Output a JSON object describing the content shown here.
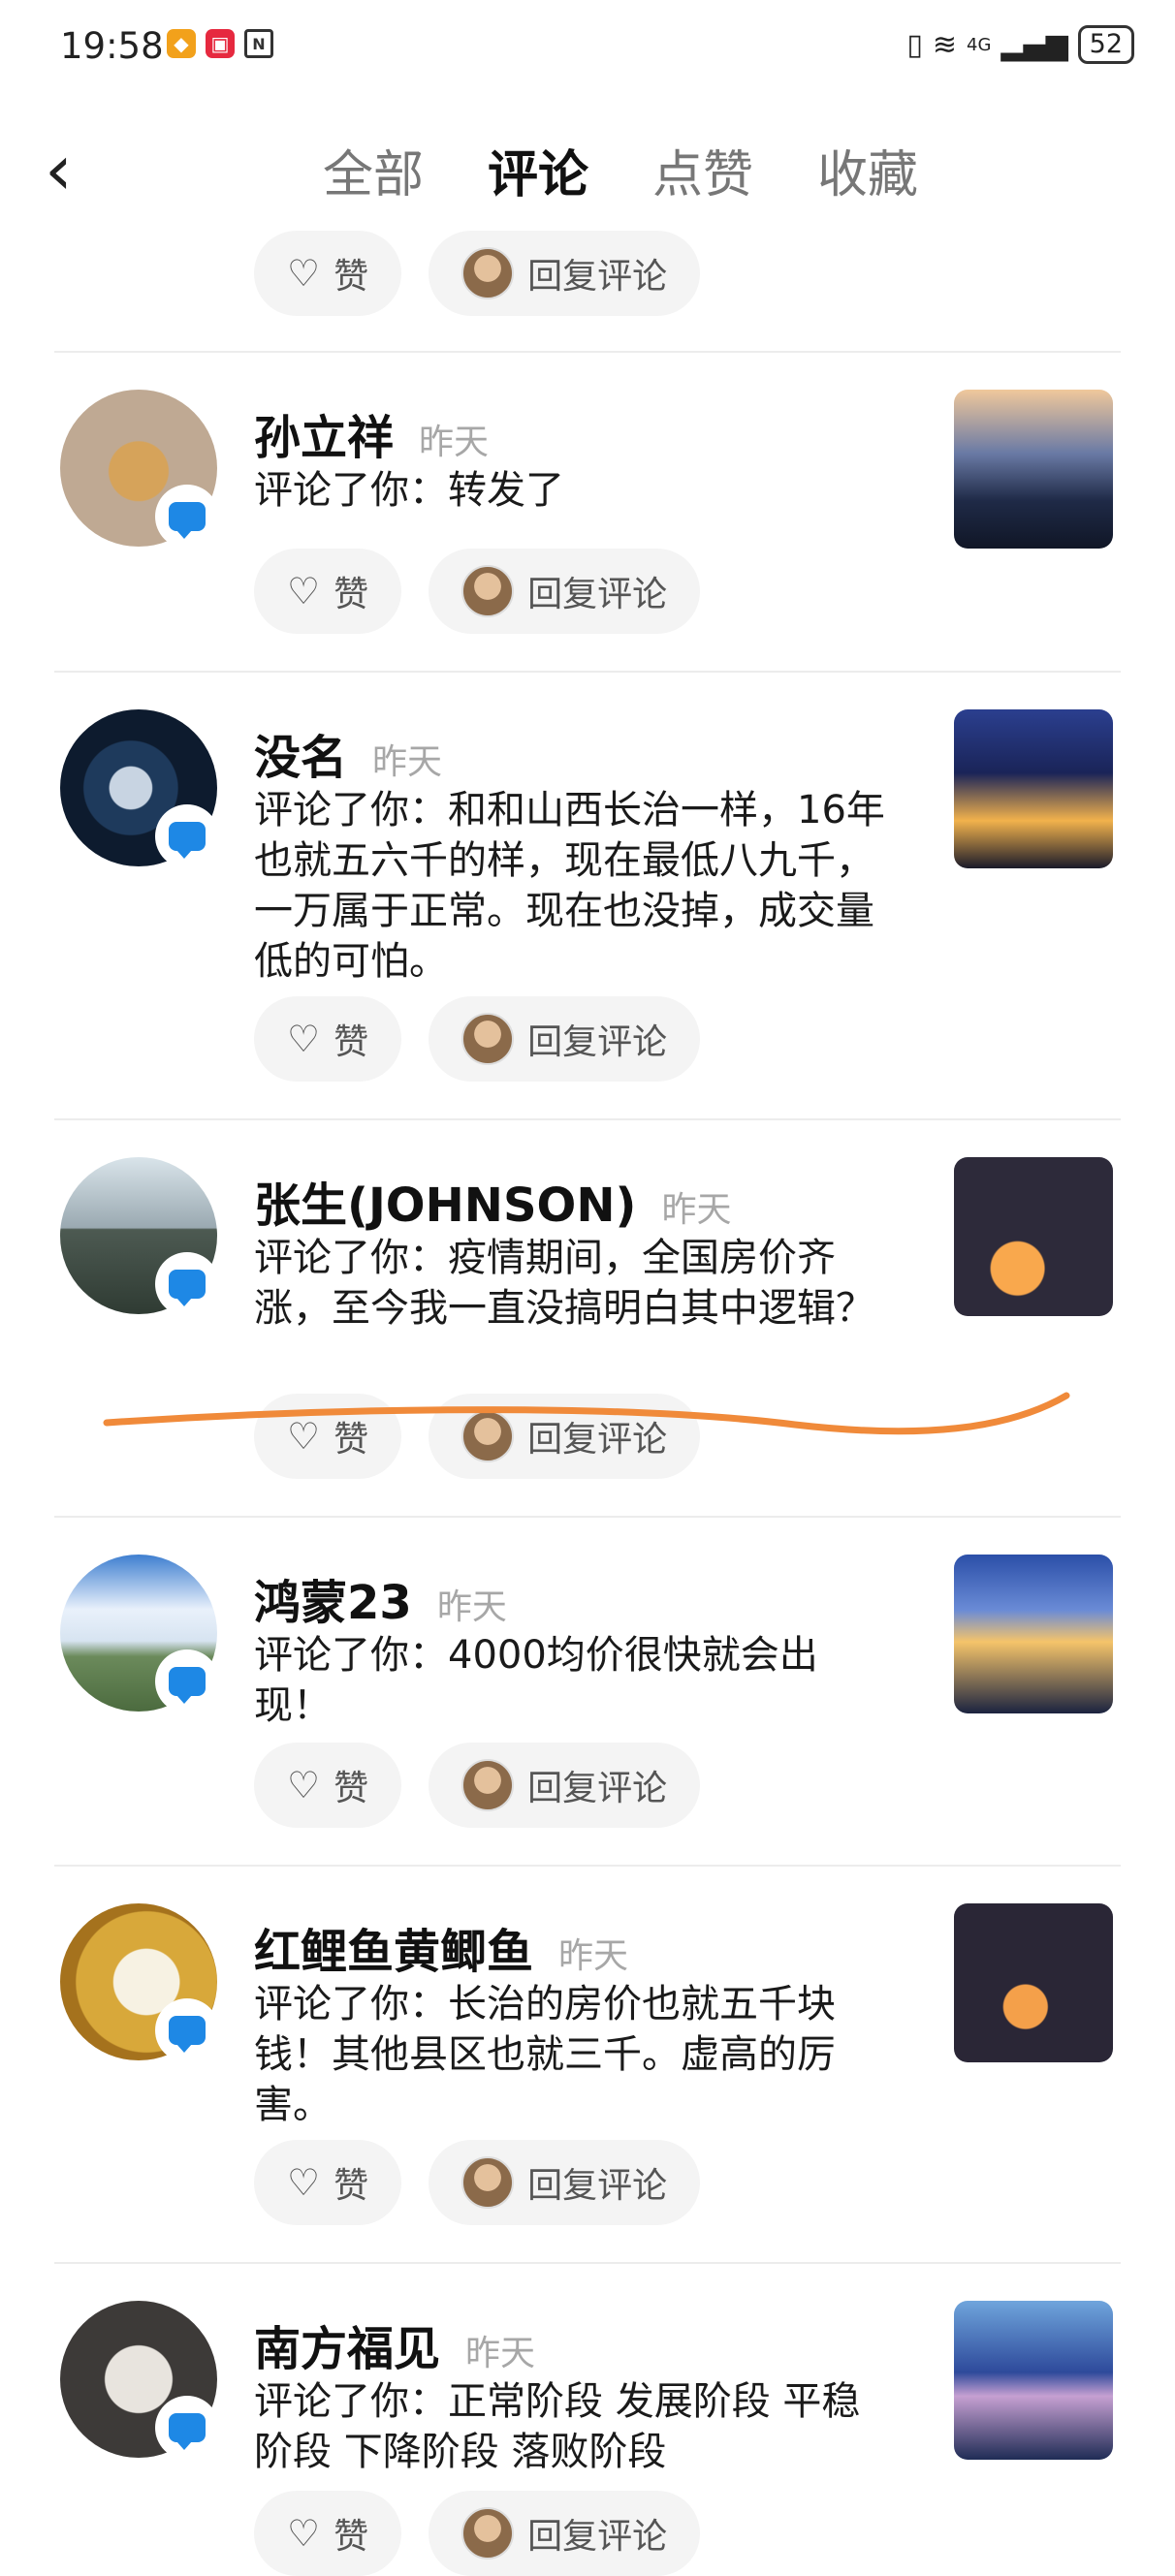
{
  "status_bar": {
    "time": "19:58",
    "signal_text": "4G",
    "battery": "52"
  },
  "header": {
    "back_icon": "chevron-left",
    "tabs": [
      {
        "label": "全部"
      },
      {
        "label": "评论",
        "active": true
      },
      {
        "label": "点赞"
      },
      {
        "label": "收藏"
      }
    ]
  },
  "actions": {
    "like_label": "赞",
    "reply_label": "回复评论"
  },
  "comments": [
    {
      "name": "孙立祥",
      "time": "昨天",
      "text": "评论了你：转发了"
    },
    {
      "name": "没名",
      "time": "昨天",
      "text": "评论了你：和和山西长治一样，16年也就五六千的样，现在最低八九千，一万属于正常。现在也没掉，成交量低的可怕。"
    },
    {
      "name": "张生(JOHNSON)",
      "time": "昨天",
      "text": "评论了你：疫情期间，全国房价齐涨，至今我一直没搞明白其中逻辑？"
    },
    {
      "name": "鸿蒙23",
      "time": "昨天",
      "text": "评论了你：4000均价很快就会出现！"
    },
    {
      "name": "红鲤鱼黄鲫鱼",
      "time": "昨天",
      "text": "评论了你：长治的房价也就五千块钱！其他县区也就三千。虚高的厉害。"
    },
    {
      "name": "南方福见",
      "time": "昨天",
      "text": "评论了你：正常阶段 发展阶段 平稳阶段 下降阶段 落败阶段"
    }
  ],
  "colors": {
    "accent_blue": "#1e88e5",
    "annotation_orange": "#f08a3a"
  }
}
